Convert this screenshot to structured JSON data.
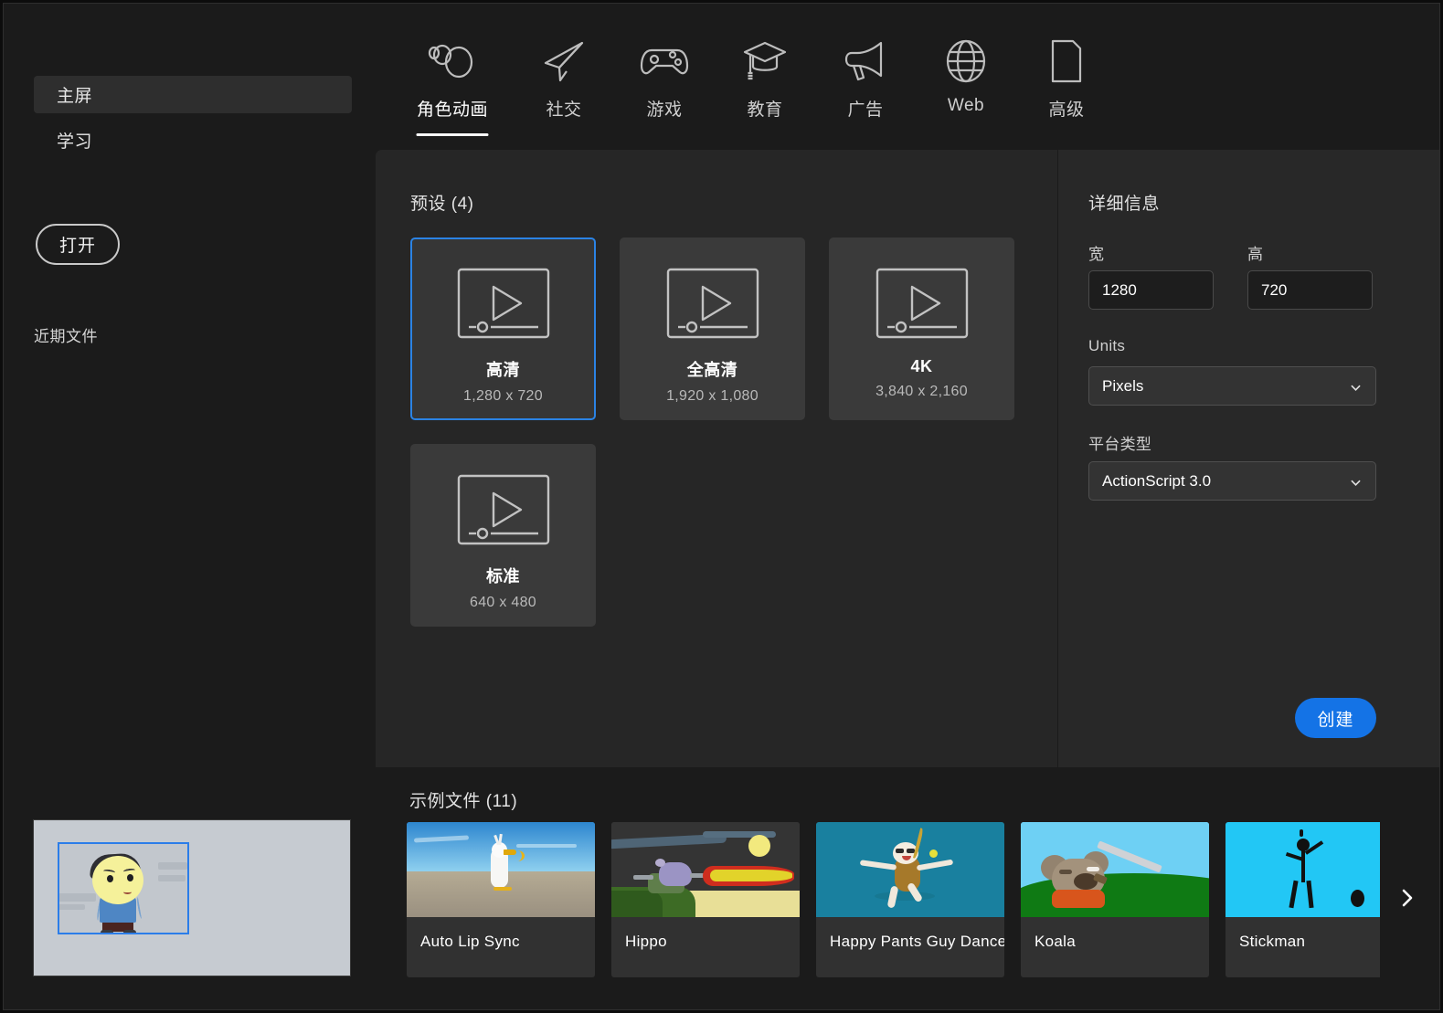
{
  "sidebar": {
    "items": [
      {
        "label": "主屏",
        "name": "home",
        "active": true
      },
      {
        "label": "学习",
        "name": "learn",
        "active": false
      }
    ],
    "open_button": "打开",
    "recent_label": "近期文件"
  },
  "tabs": [
    {
      "label": "角色动画",
      "icon": "character-animation-icon",
      "active": true
    },
    {
      "label": "社交",
      "icon": "paper-plane-icon",
      "active": false
    },
    {
      "label": "游戏",
      "icon": "gamepad-icon",
      "active": false
    },
    {
      "label": "教育",
      "icon": "graduation-cap-icon",
      "active": false
    },
    {
      "label": "广告",
      "icon": "megaphone-icon",
      "active": false
    },
    {
      "label": "Web",
      "icon": "globe-icon",
      "active": false
    },
    {
      "label": "高级",
      "icon": "document-icon",
      "active": false
    }
  ],
  "presets": {
    "title": "预设 (4)",
    "count": 4,
    "items": [
      {
        "name": "高清",
        "dims": "1,280 x 720",
        "selected": true
      },
      {
        "name": "全高清",
        "dims": "1,920 x 1,080",
        "selected": false
      },
      {
        "name": "4K",
        "dims": "3,840 x 2,160",
        "selected": false
      },
      {
        "name": "标准",
        "dims": "640 x 480",
        "selected": false
      }
    ]
  },
  "details": {
    "title": "详细信息",
    "width_label": "宽",
    "width_value": "1280",
    "height_label": "高",
    "height_value": "720",
    "units_label": "Units",
    "units_value": "Pixels",
    "platform_label": "平台类型",
    "platform_value": "ActionScript 3.0",
    "create_button": "创建"
  },
  "samples": {
    "title": "示例文件 (11)",
    "count": 11,
    "items": [
      {
        "name": "Auto Lip Sync",
        "scene": "seagull-beach"
      },
      {
        "name": "Hippo",
        "scene": "hippo-night"
      },
      {
        "name": "Happy Pants Guy Dance",
        "scene": "dancer-teal"
      },
      {
        "name": "Koala",
        "scene": "koala-field"
      },
      {
        "name": "Stickman",
        "scene": "stickman-cyan"
      }
    ],
    "next_arrow": "chevron-right-icon"
  },
  "colors": {
    "accent": "#1473e6",
    "selection": "#2b83e4",
    "app_background": "#1b1b1b",
    "panel_background": "#262626",
    "details_background": "#282828",
    "card_background": "#3a3a3a"
  }
}
